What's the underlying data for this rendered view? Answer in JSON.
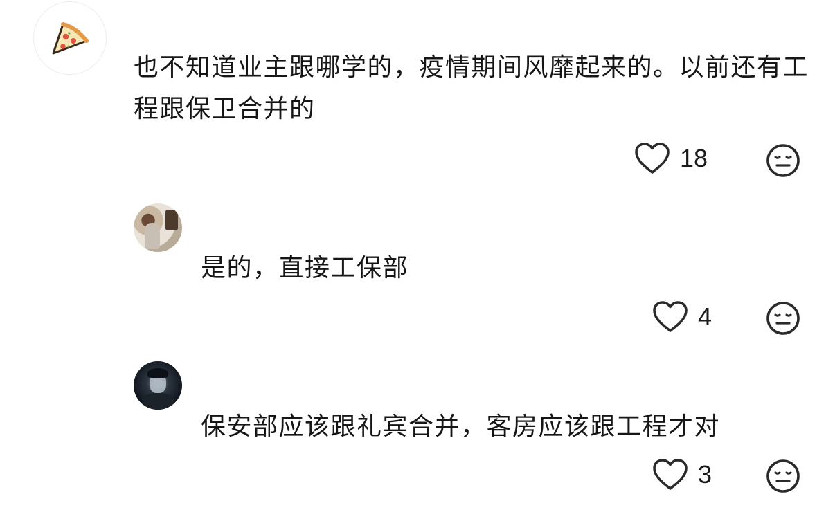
{
  "comments": [
    {
      "avatar_icon": "pizza-slice-icon",
      "text": "也不知道业主跟哪学的，疫情期间风靡起来的。以前还有工程跟保卫合并的",
      "likes": "18"
    }
  ],
  "replies": [
    {
      "avatar_icon": "user-photo-avatar",
      "text": "是的，直接工保部",
      "likes": "4"
    },
    {
      "avatar_icon": "user-photo-avatar",
      "text": "保安部应该跟礼宾合并，客房应该跟工程才对",
      "likes": "3"
    }
  ],
  "icons": {
    "like": "heart-outline-icon",
    "dislike": "neutral-face-icon"
  },
  "colors": {
    "text": "#161616",
    "icon_stroke": "#2a2a2a",
    "background": "#ffffff"
  }
}
